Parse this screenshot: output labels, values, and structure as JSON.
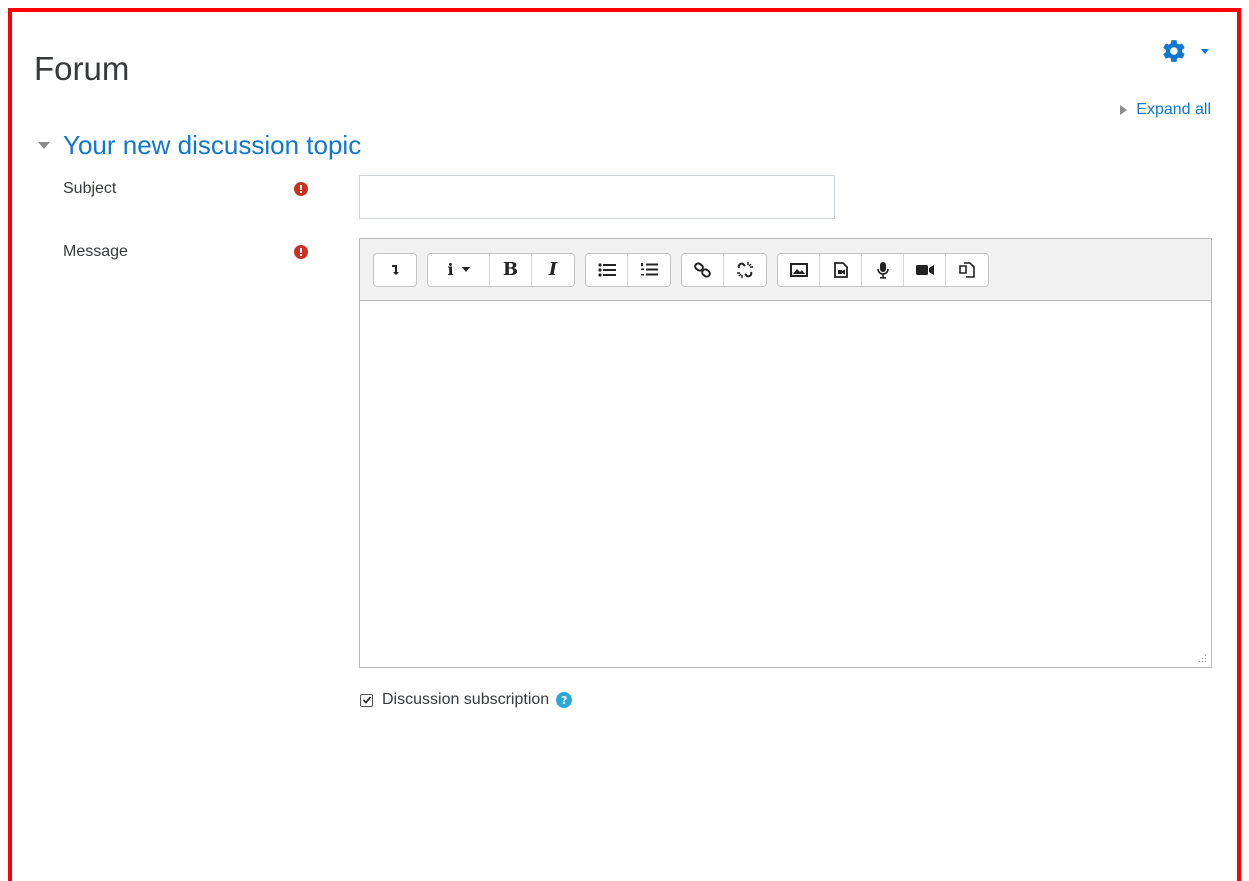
{
  "page": {
    "title": "Forum"
  },
  "header": {
    "expand_all_label": "Expand all"
  },
  "section": {
    "title": "Your new discussion topic"
  },
  "form": {
    "subject": {
      "label": "Subject",
      "value": "",
      "required_marker": "!"
    },
    "message": {
      "label": "Message",
      "required_marker": "!"
    },
    "subscription": {
      "label": "Discussion subscription",
      "checked": true,
      "help_glyph": "?"
    }
  },
  "toolbar": {
    "groups": [
      [
        "collapse-icon"
      ],
      [
        "info-dropdown-icon",
        "bold-icon",
        "italic-icon"
      ],
      [
        "unordered-list-icon",
        "ordered-list-icon"
      ],
      [
        "link-icon",
        "unlink-icon"
      ],
      [
        "image-icon",
        "media-icon",
        "record-audio-icon",
        "record-video-icon",
        "manage-files-icon"
      ]
    ],
    "bold_glyph": "B",
    "italic_glyph": "I",
    "info_glyph": "i"
  },
  "colors": {
    "accent": "#1177d1",
    "required": "#ca3120",
    "help": "#2aa9d8",
    "frame": "#ff0000"
  }
}
